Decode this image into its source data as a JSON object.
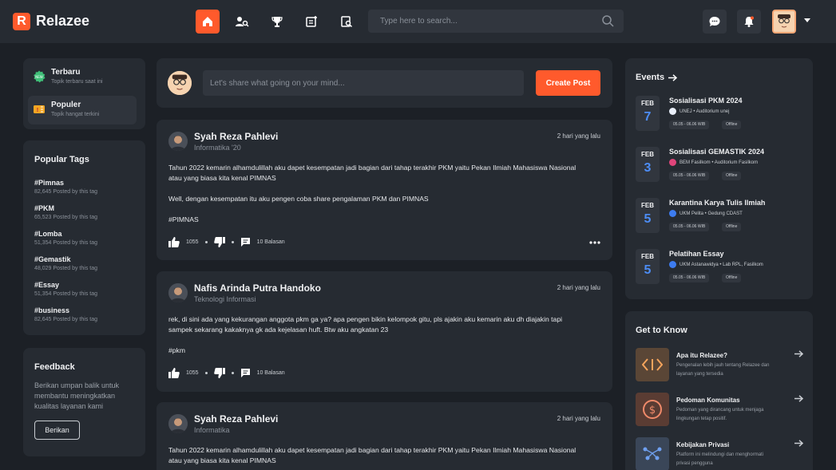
{
  "app": {
    "logo_letter": "R",
    "name": "Relazee"
  },
  "search": {
    "placeholder": "Type here to search..."
  },
  "composer": {
    "placeholder": "Let's share what going on your mind...",
    "button": "Create Post"
  },
  "sidebar": {
    "items": [
      {
        "title": "Terbaru",
        "subtitle": "Topik terbaru saat ini"
      },
      {
        "title": "Populer",
        "subtitle": "Topik hangat terkini"
      }
    ]
  },
  "popular_tags": {
    "title": "Popular Tags",
    "tags": [
      {
        "name": "#Pimnas",
        "count": "82,645 Posted by this tag"
      },
      {
        "name": "#PKM",
        "count": "65,523 Posted by this tag"
      },
      {
        "name": "#Lomba",
        "count": "51,354 Posted by this tag"
      },
      {
        "name": "#Gemastik",
        "count": "48,029 Posted by this tag"
      },
      {
        "name": "#Essay",
        "count": "51,354 Posted by this tag"
      },
      {
        "name": "#business",
        "count": "82,645 Posted by this tag"
      }
    ]
  },
  "feedback": {
    "title": "Feedback",
    "text": "Berikan umpan balik untuk membantu meningkatkan kualitas layanan kami",
    "button": "Berikan"
  },
  "posts": [
    {
      "name": "Syah Reza Pahlevi",
      "sub": "Informatika '20",
      "time": "2 hari yang lalu",
      "p1": "Tahun 2022 kemarin alhamdulillah aku dapet kesempatan jadi bagian dari tahap terakhir PKM yaitu Pekan Ilmiah Mahasiswa Nasional atau yang biasa kita kenal PIMNAS",
      "p2": "Well, dengan kesempatan itu aku pengen coba share pengalaman PKM dan PIMNAS",
      "p3": "#PIMNAS",
      "likes": "1055",
      "replies": "10 Balasan"
    },
    {
      "name": "Nafis Arinda Putra Handoko",
      "sub": "Teknologi Informasi",
      "time": "2 hari yang lalu",
      "p1": "rek, di sini ada yang kekurangan anggota pkm ga ya? apa pengen bikin kelompok gitu, pls ajakin aku kemarin aku dh diajakin tapi sampek sekarang kakaknya gk ada kejelasan huft. Btw aku angkatan 23",
      "p2": "#pkm",
      "likes": "1055",
      "replies": "10 Balasan"
    },
    {
      "name": "Syah Reza Pahlevi",
      "sub": "Informatika",
      "time": "2 hari yang lalu",
      "p1": "Tahun 2022 kemarin alhamdulillah aku dapet kesempatan jadi bagian dari tahap terakhir PKM yaitu Pekan Ilmiah Mahasiswa Nasional atau yang biasa kita kenal PIMNAS"
    }
  ],
  "events": {
    "title": "Events",
    "items": [
      {
        "month": "FEB",
        "day": "7",
        "title": "Sosialisasi PKM 2024",
        "org": "UNEJ • Auditorium unej",
        "time": "05.05 - 06.06 WIB",
        "mode": "Offline",
        "badge_color": "#e8eef8"
      },
      {
        "month": "FEB",
        "day": "3",
        "title": "Sosialisasi GEMASTIK 2024",
        "org": "BEM Fasilkom • Auditorium Fasilkom",
        "time": "05.05 - 06.06 WIB",
        "mode": "Offline",
        "badge_color": "#e0457b"
      },
      {
        "month": "FEB",
        "day": "5",
        "title": "Karantina Karya Tulis Ilmiah",
        "org": "UKM Pelita • Gedung CDAST",
        "time": "05.05 - 06.06 WIB",
        "mode": "Offline",
        "badge_color": "#3d7cf0"
      },
      {
        "month": "FEB",
        "day": "5",
        "title": "Pelatihan Essay",
        "org": "UKM Astanawidya • Lab RPL, Fasilkom",
        "time": "05.05 - 06.06 WIB",
        "mode": "Offline",
        "badge_color": "#3d7cf0"
      }
    ]
  },
  "get_to_know": {
    "title": "Get to Know",
    "items": [
      {
        "title": "Apa itu Relazee?",
        "desc": "Pengenalan lebih jauh tentang Relazee dan layanan yang tersedia",
        "icon": "code-icon"
      },
      {
        "title": "Pedoman Komunitas",
        "desc": "Pedoman yang dirancang untuk menjaga lingkungan tetap positif.",
        "icon": "dollar-icon"
      },
      {
        "title": "Kebijakan Privasi",
        "desc": "Platform ini melindungi dan menghormati privasi pengguna",
        "icon": "privacy-icon"
      }
    ]
  },
  "colors": {
    "accent": "#ff5a2c",
    "bg": "#1c2026",
    "card": "#262b32",
    "date_blue": "#4d8df5"
  }
}
